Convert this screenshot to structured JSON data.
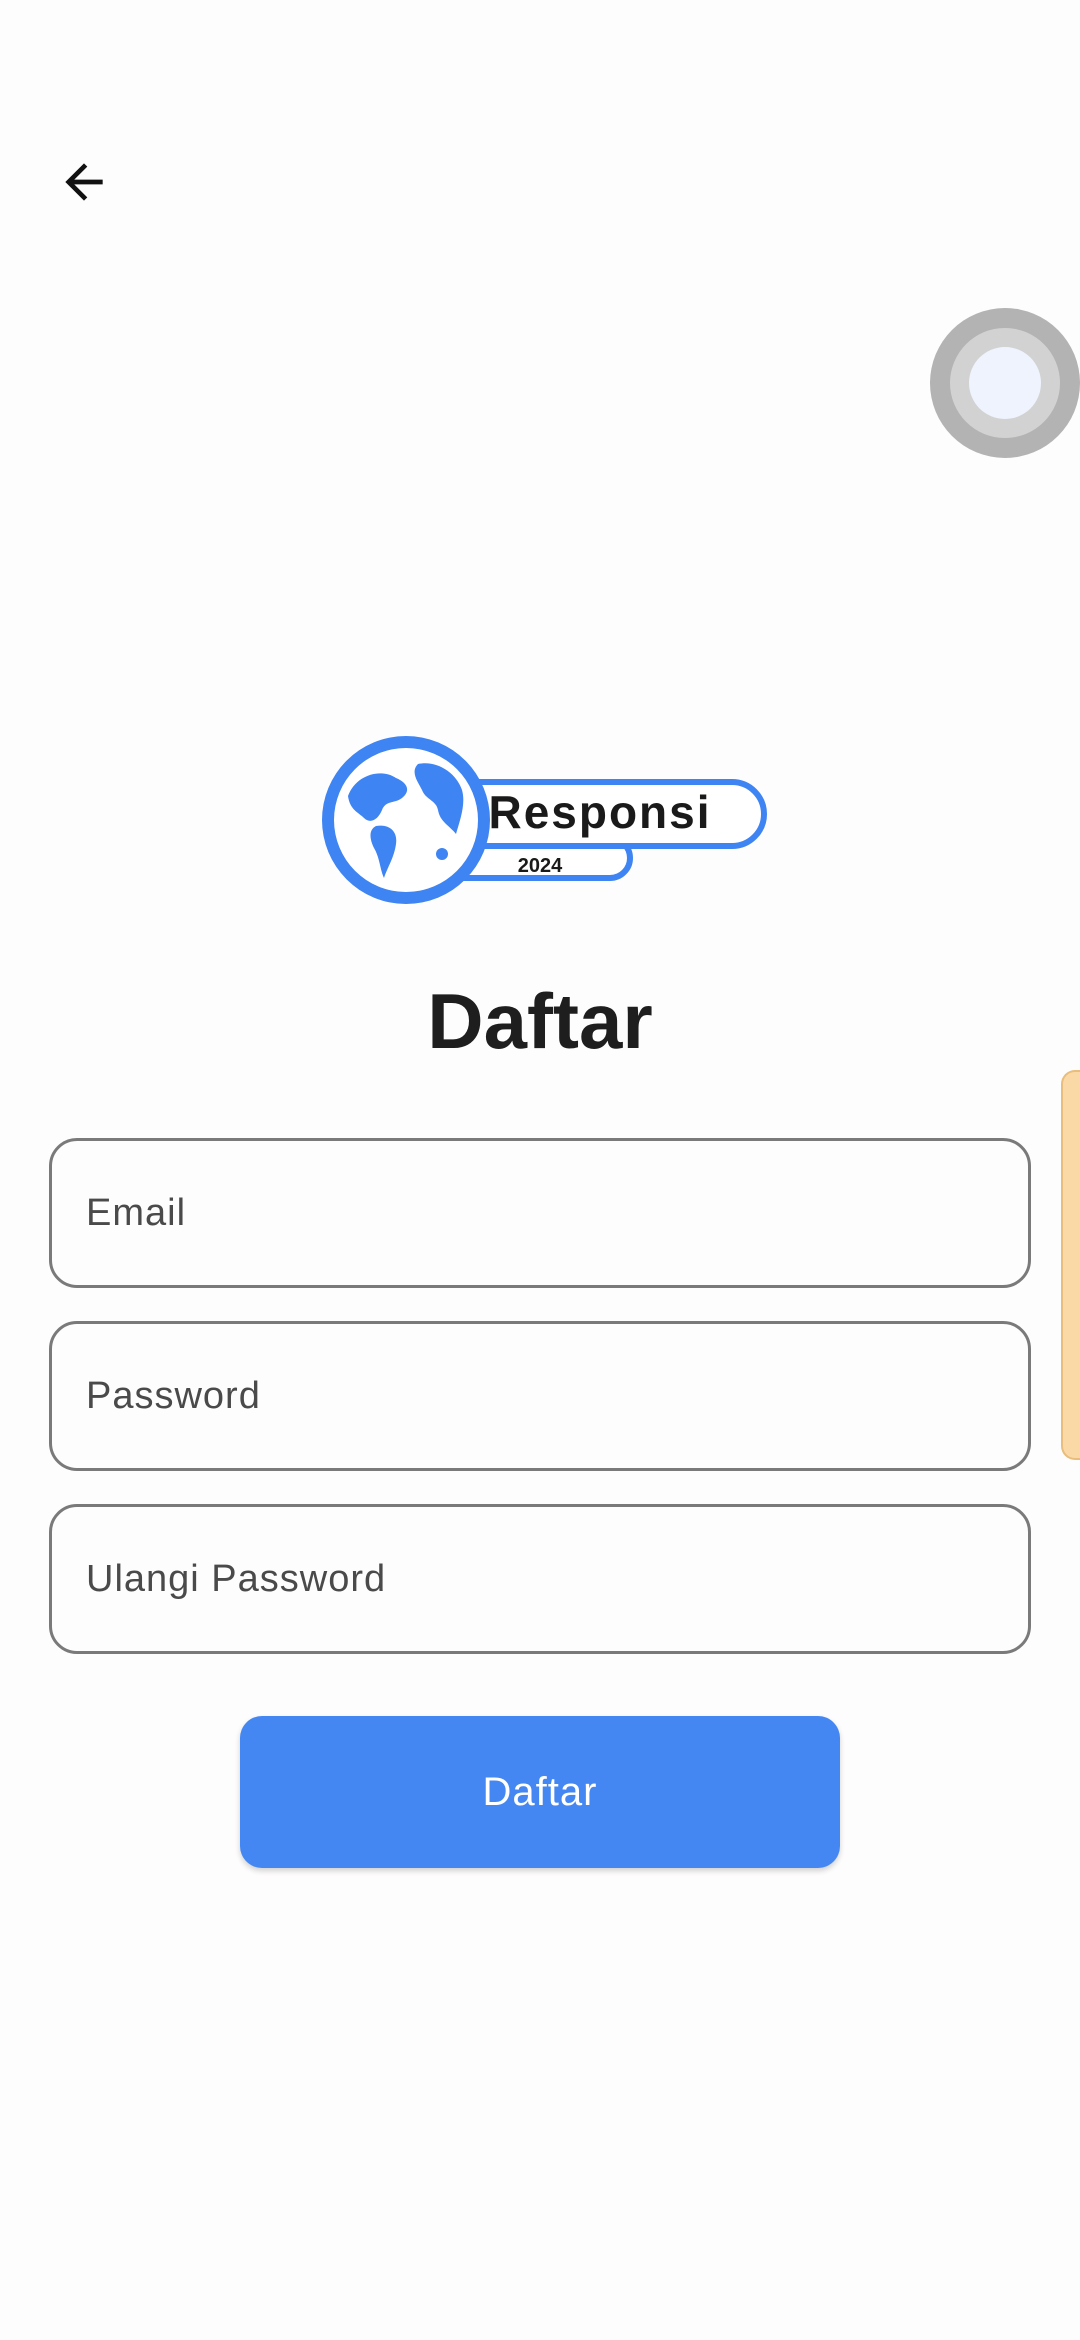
{
  "header": {
    "back_icon": "arrow-left-icon"
  },
  "overlay": {
    "assistive_touch_icon": "assistive-touch-icon"
  },
  "logo": {
    "name": "Responsi",
    "year": "2024",
    "icon": "globe-icon",
    "color": "#3e84f2"
  },
  "form": {
    "title": "Daftar",
    "email_placeholder": "Email",
    "password_placeholder": "Password",
    "repeat_password_placeholder": "Ulangi Password",
    "submit_label": "Daftar"
  },
  "colors": {
    "accent": "#4487f3",
    "border": "#7a7a7a",
    "title": "#1e1e1e"
  }
}
